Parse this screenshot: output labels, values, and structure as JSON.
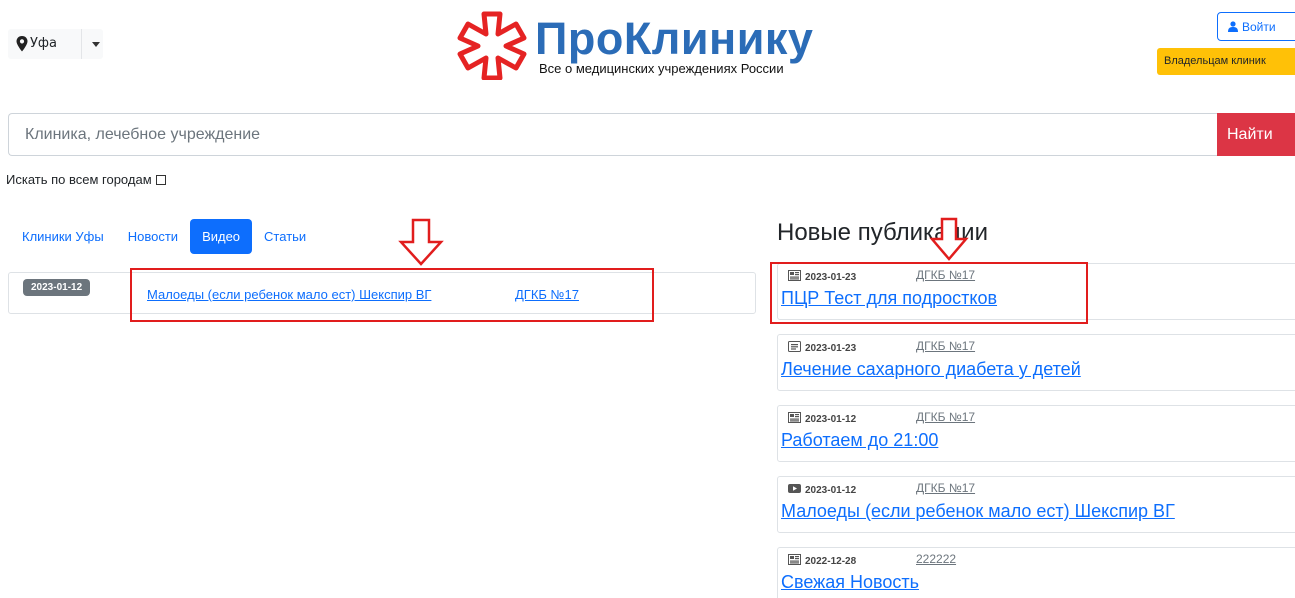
{
  "header": {
    "city": "Уфа",
    "logo_title": "ПроКлинику",
    "logo_subtitle": "Все о медицинских учреждениях России",
    "login_label": "Войти",
    "owners_label": "Владельцам клиник"
  },
  "search": {
    "placeholder": "Клиника, лечебное учреждение",
    "button_label": "Найти",
    "all_cities_label": "Искать по всем городам"
  },
  "tabs": [
    {
      "label": "Клиники Уфы",
      "active": false
    },
    {
      "label": "Новости",
      "active": false
    },
    {
      "label": "Видео",
      "active": true
    },
    {
      "label": "Статьи",
      "active": false
    }
  ],
  "video_list": [
    {
      "date": "2023-01-12",
      "title": "Малоеды (если ребенок мало ест) Шекспир ВГ",
      "clinic": "ДГКБ №17"
    }
  ],
  "publications": {
    "heading": "Новые публикации",
    "items": [
      {
        "icon": "news-icon",
        "date": "2023-01-23",
        "clinic": "ДГКБ №17",
        "title": "ПЦР Тест для подростков"
      },
      {
        "icon": "article-icon",
        "date": "2023-01-23",
        "clinic": "ДГКБ №17",
        "title": "Лечение сахарного диабета у детей"
      },
      {
        "icon": "news-icon",
        "date": "2023-01-12",
        "clinic": "ДГКБ №17",
        "title": "Работаем до 21:00"
      },
      {
        "icon": "video-icon",
        "date": "2023-01-12",
        "clinic": "ДГКБ №17",
        "title": "Малоеды (если ребенок мало ест) Шекспир ВГ"
      },
      {
        "icon": "news-icon",
        "date": "2022-12-28",
        "clinic": "222222",
        "title": "Свежая Новость"
      }
    ]
  },
  "colors": {
    "primary": "#0d6efd",
    "danger": "#dc3545",
    "warning": "#ffc107",
    "logo": "#2b6cb7",
    "annotation": "#e11d1d"
  }
}
